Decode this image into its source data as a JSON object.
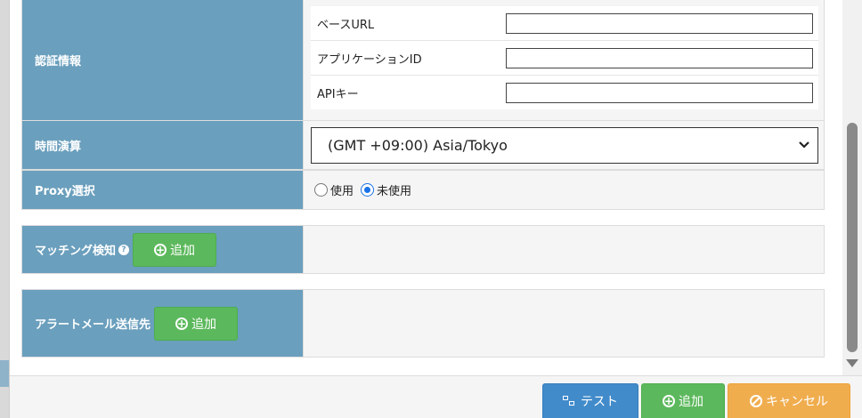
{
  "auth": {
    "header": "認証情報",
    "fields": [
      {
        "label": "ベースURL",
        "value": ""
      },
      {
        "label": "アプリケーションID",
        "value": ""
      },
      {
        "label": "APIキー",
        "value": ""
      }
    ]
  },
  "time": {
    "header": "時間演算",
    "selected": "(GMT +09:00) Asia/Tokyo"
  },
  "proxy": {
    "header": "Proxy選択",
    "options": [
      "使用",
      "未使用"
    ],
    "selected_index": 1
  },
  "matching": {
    "header": "マッチング検知",
    "help": "?",
    "add_label": "追加"
  },
  "alert": {
    "header": "アラートメール送信先",
    "add_label": "追加"
  },
  "footer": {
    "test_label": "テスト",
    "add_label": "追加",
    "cancel_label": "キャンセル"
  },
  "icons": {
    "plus": "plus-circle-icon",
    "chevron": "chevron-down-icon",
    "test": "sitemap-icon",
    "cancel": "ban-icon",
    "help": "question-circle-icon"
  },
  "colors": {
    "header_bg": "#6a9fbd",
    "green": "#5cb85c",
    "blue": "#428bca",
    "orange": "#f0ad4e"
  }
}
